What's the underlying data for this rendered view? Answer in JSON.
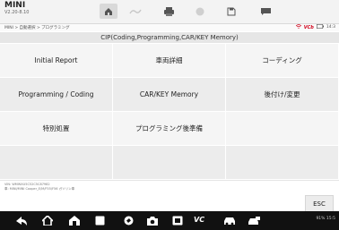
{
  "app": {
    "name": "MINI",
    "version": "V2.20-8.10"
  },
  "toolbar": {
    "icons": [
      "home-icon",
      "vehicle-menu-icon",
      "print-icon",
      "help-icon",
      "save-icon",
      "data-icon"
    ]
  },
  "breadcrumb": {
    "path": "MINI > 自動選択 > プログラミング",
    "vcb": "VCb",
    "status_right": "14:3"
  },
  "page": {
    "title": "CIP(Coding,Programming,CAR/KEY Memory)"
  },
  "menu": {
    "items": [
      {
        "label": "Initial Report"
      },
      {
        "label": "車両詳細"
      },
      {
        "label": "コーディング"
      },
      {
        "label": "Programming / Coding"
      },
      {
        "label": "CAR/KEY Memory"
      },
      {
        "label": "後付け/変更"
      },
      {
        "label": "特別処置"
      },
      {
        "label": "プログラミング後準備"
      },
      {
        "label": ""
      },
      {
        "label": ""
      },
      {
        "label": ""
      },
      {
        "label": ""
      }
    ]
  },
  "footer": {
    "vin_line": "VIN: WMWXU5C52C5C87982",
    "model_line": "車: MINI/MINI Cooper_E/M/F55/F56 ガソリン車",
    "esc_label": "ESC"
  },
  "navbar": {
    "icons": [
      "back-icon",
      "home-icon",
      "house-icon",
      "recents-icon",
      "browser-icon",
      "camera-icon",
      "screen-record-icon",
      "vc-icon",
      "car-icon",
      "car-battery-icon"
    ],
    "vc_label": "VC",
    "system_status": "91%",
    "clock": "15:5"
  },
  "colors": {
    "accent_red": "#d0021b",
    "topbar_bg": "#f3f3f3",
    "cell_light": "#f5f5f5",
    "cell_dark": "#ececec"
  }
}
